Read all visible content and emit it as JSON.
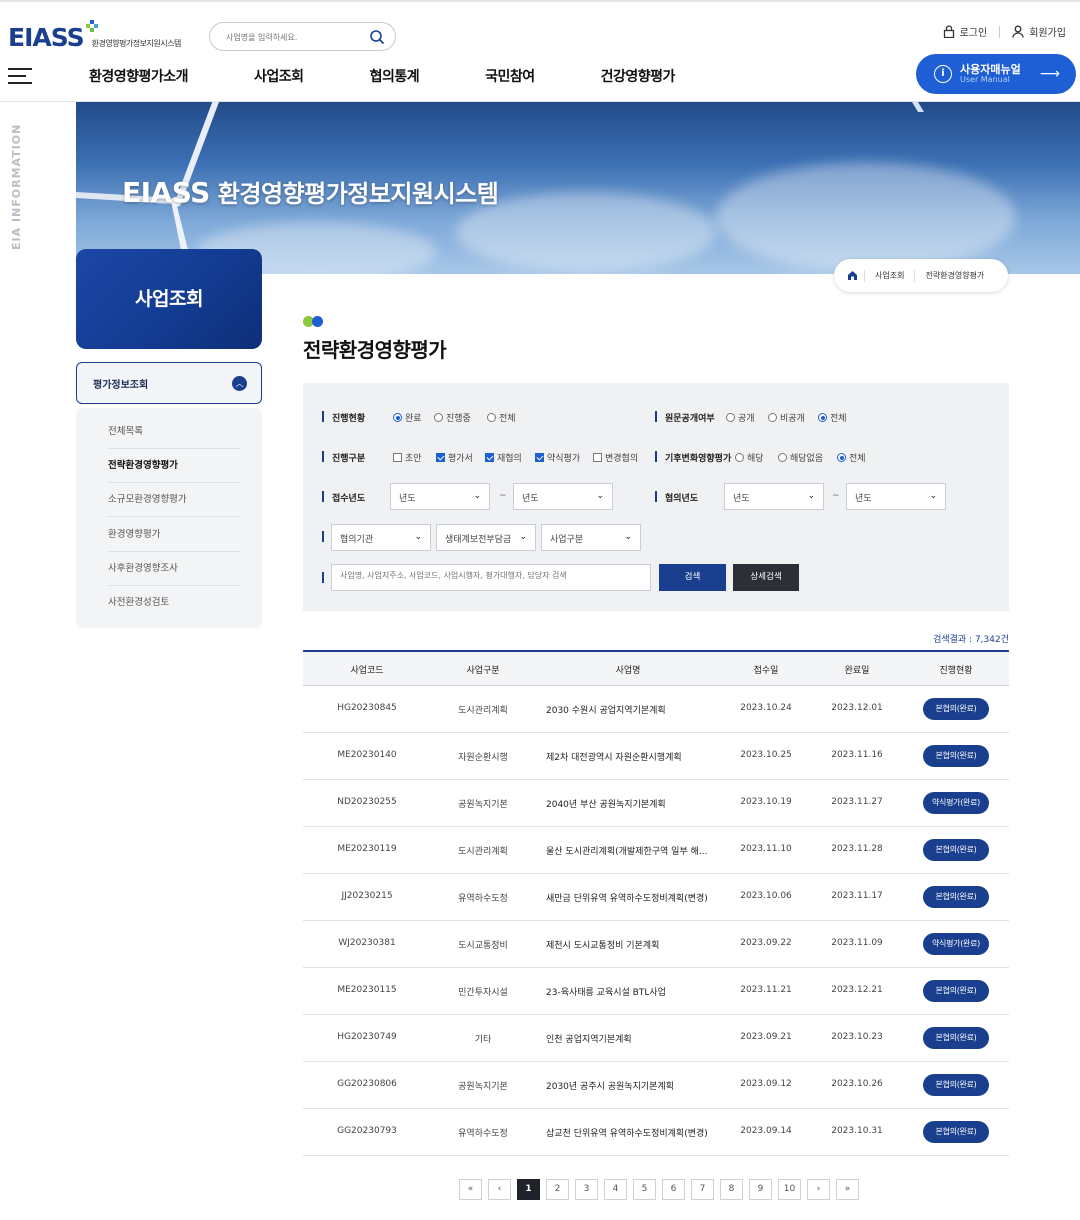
{
  "header": {
    "logo_text": "EIASS",
    "logo_sub": "환경영향평가정보지원시스템",
    "search_placeholder": "사업명을 입력하세요.",
    "login": "로그인",
    "signup": "회원가입",
    "nav": [
      "환경영향평가소개",
      "사업조회",
      "협의통계",
      "국민참여",
      "건강영향평가"
    ],
    "manual_title": "사용자매뉴얼",
    "manual_sub": "User Manual"
  },
  "side_vertical_text": "EIA INFORMATION",
  "hero": {
    "title_brand": "EIASS",
    "title_rest": "환경영향평가정보지원시스템"
  },
  "breadcrumb": [
    "사업조회",
    "전략환경영향평가"
  ],
  "lnb": {
    "title": "사업조회",
    "selected_group": "평가정보조회",
    "items": [
      "전체목록",
      "전략환경영향평가",
      "소규모환경영향평가",
      "환경영향평가",
      "사후환경영향조사",
      "사전환경성검토"
    ],
    "active_index": 1
  },
  "page_title": "전략환경영향평가",
  "filter": {
    "status_label": "진행현황",
    "status_options": [
      "완료",
      "진행중",
      "전체"
    ],
    "status_selected": "완료",
    "open_label": "원문공개여부",
    "open_options": [
      "공개",
      "비공개",
      "전체"
    ],
    "open_selected": "전체",
    "stage_label": "진행구분",
    "stage_options": [
      {
        "label": "초안",
        "checked": false
      },
      {
        "label": "평가서",
        "checked": true
      },
      {
        "label": "재협의",
        "checked": true
      },
      {
        "label": "약식평가",
        "checked": true
      },
      {
        "label": "변경협의",
        "checked": false
      }
    ],
    "climate_label": "기후변화영향평가",
    "climate_options": [
      "해당",
      "해당없음",
      "전체"
    ],
    "climate_selected": "전체",
    "receipt_year_label": "접수년도",
    "consult_year_label": "협의년도",
    "year_placeholder": "년도",
    "agency_placeholder": "협의기관",
    "eco_placeholder": "생태계보전부담금",
    "biztype_placeholder": "사업구분",
    "keyword_placeholder": "사업명, 사업지주소, 사업코드, 사업시행자, 평가대행자, 담당자 검색",
    "search_button": "검색",
    "detail_button": "상세검색"
  },
  "result_count": "검색결과 : 7,342건",
  "table": {
    "headers": [
      "사업코드",
      "사업구분",
      "사업명",
      "접수일",
      "완료일",
      "진행현황"
    ],
    "rows": [
      {
        "code": "HG20230845",
        "type": "도시관리계획",
        "name": "2030 수원시 공업지역기본계획",
        "recv": "2023.10.24",
        "done": "2023.12.01",
        "status": "본협의(완료)"
      },
      {
        "code": "ME20230140",
        "type": "자원순환시행",
        "name": "제2차 대전광역시 자원순환시행계획",
        "recv": "2023.10.25",
        "done": "2023.11.16",
        "status": "본협의(완료)"
      },
      {
        "code": "ND20230255",
        "type": "공원녹지기본",
        "name": "2040년 부산 공원녹지기본계획",
        "recv": "2023.10.19",
        "done": "2023.11.27",
        "status": "약식평가(완료)"
      },
      {
        "code": "ME20230119",
        "type": "도시관리계획",
        "name": "울산 도시관리계획(개발제한구역 일부 해...",
        "recv": "2023.11.10",
        "done": "2023.11.28",
        "status": "본협의(완료)"
      },
      {
        "code": "JJ20230215",
        "type": "유역하수도정",
        "name": "새만금 단위유역 유역하수도정비계획(변경)",
        "recv": "2023.10.06",
        "done": "2023.11.17",
        "status": "본협의(완료)"
      },
      {
        "code": "WJ20230381",
        "type": "도시교통정비",
        "name": "제천시 도시교통정비 기본계획",
        "recv": "2023.09.22",
        "done": "2023.11.09",
        "status": "약식평가(완료)"
      },
      {
        "code": "ME20230115",
        "type": "민간투자시설",
        "name": "23-육사태릉 교육시설 BTL사업",
        "recv": "2023.11.21",
        "done": "2023.12.21",
        "status": "본협의(완료)"
      },
      {
        "code": "HG20230749",
        "type": "기타",
        "name": "인천 공업지역기본계획",
        "recv": "2023.09.21",
        "done": "2023.10.23",
        "status": "본협의(완료)"
      },
      {
        "code": "GG20230806",
        "type": "공원녹지기본",
        "name": "2030년 공주시 공원녹지기본계획",
        "recv": "2023.09.12",
        "done": "2023.10.26",
        "status": "본협의(완료)"
      },
      {
        "code": "GG20230793",
        "type": "유역하수도정",
        "name": "삽교천 단위유역 유역하수도정비계획(변경)",
        "recv": "2023.09.14",
        "done": "2023.10.31",
        "status": "본협의(완료)"
      }
    ]
  },
  "pagination": {
    "first": "«",
    "prev": "‹",
    "next": "›",
    "last": "»",
    "pages": [
      "1",
      "2",
      "3",
      "4",
      "5",
      "6",
      "7",
      "8",
      "9",
      "10"
    ],
    "current": "1"
  },
  "colors": {
    "primary": "#1b3f8f",
    "accent_blue": "#1f5fd6",
    "logo_green": "#8dc63f",
    "logo_blue": "#1f5fd6"
  }
}
